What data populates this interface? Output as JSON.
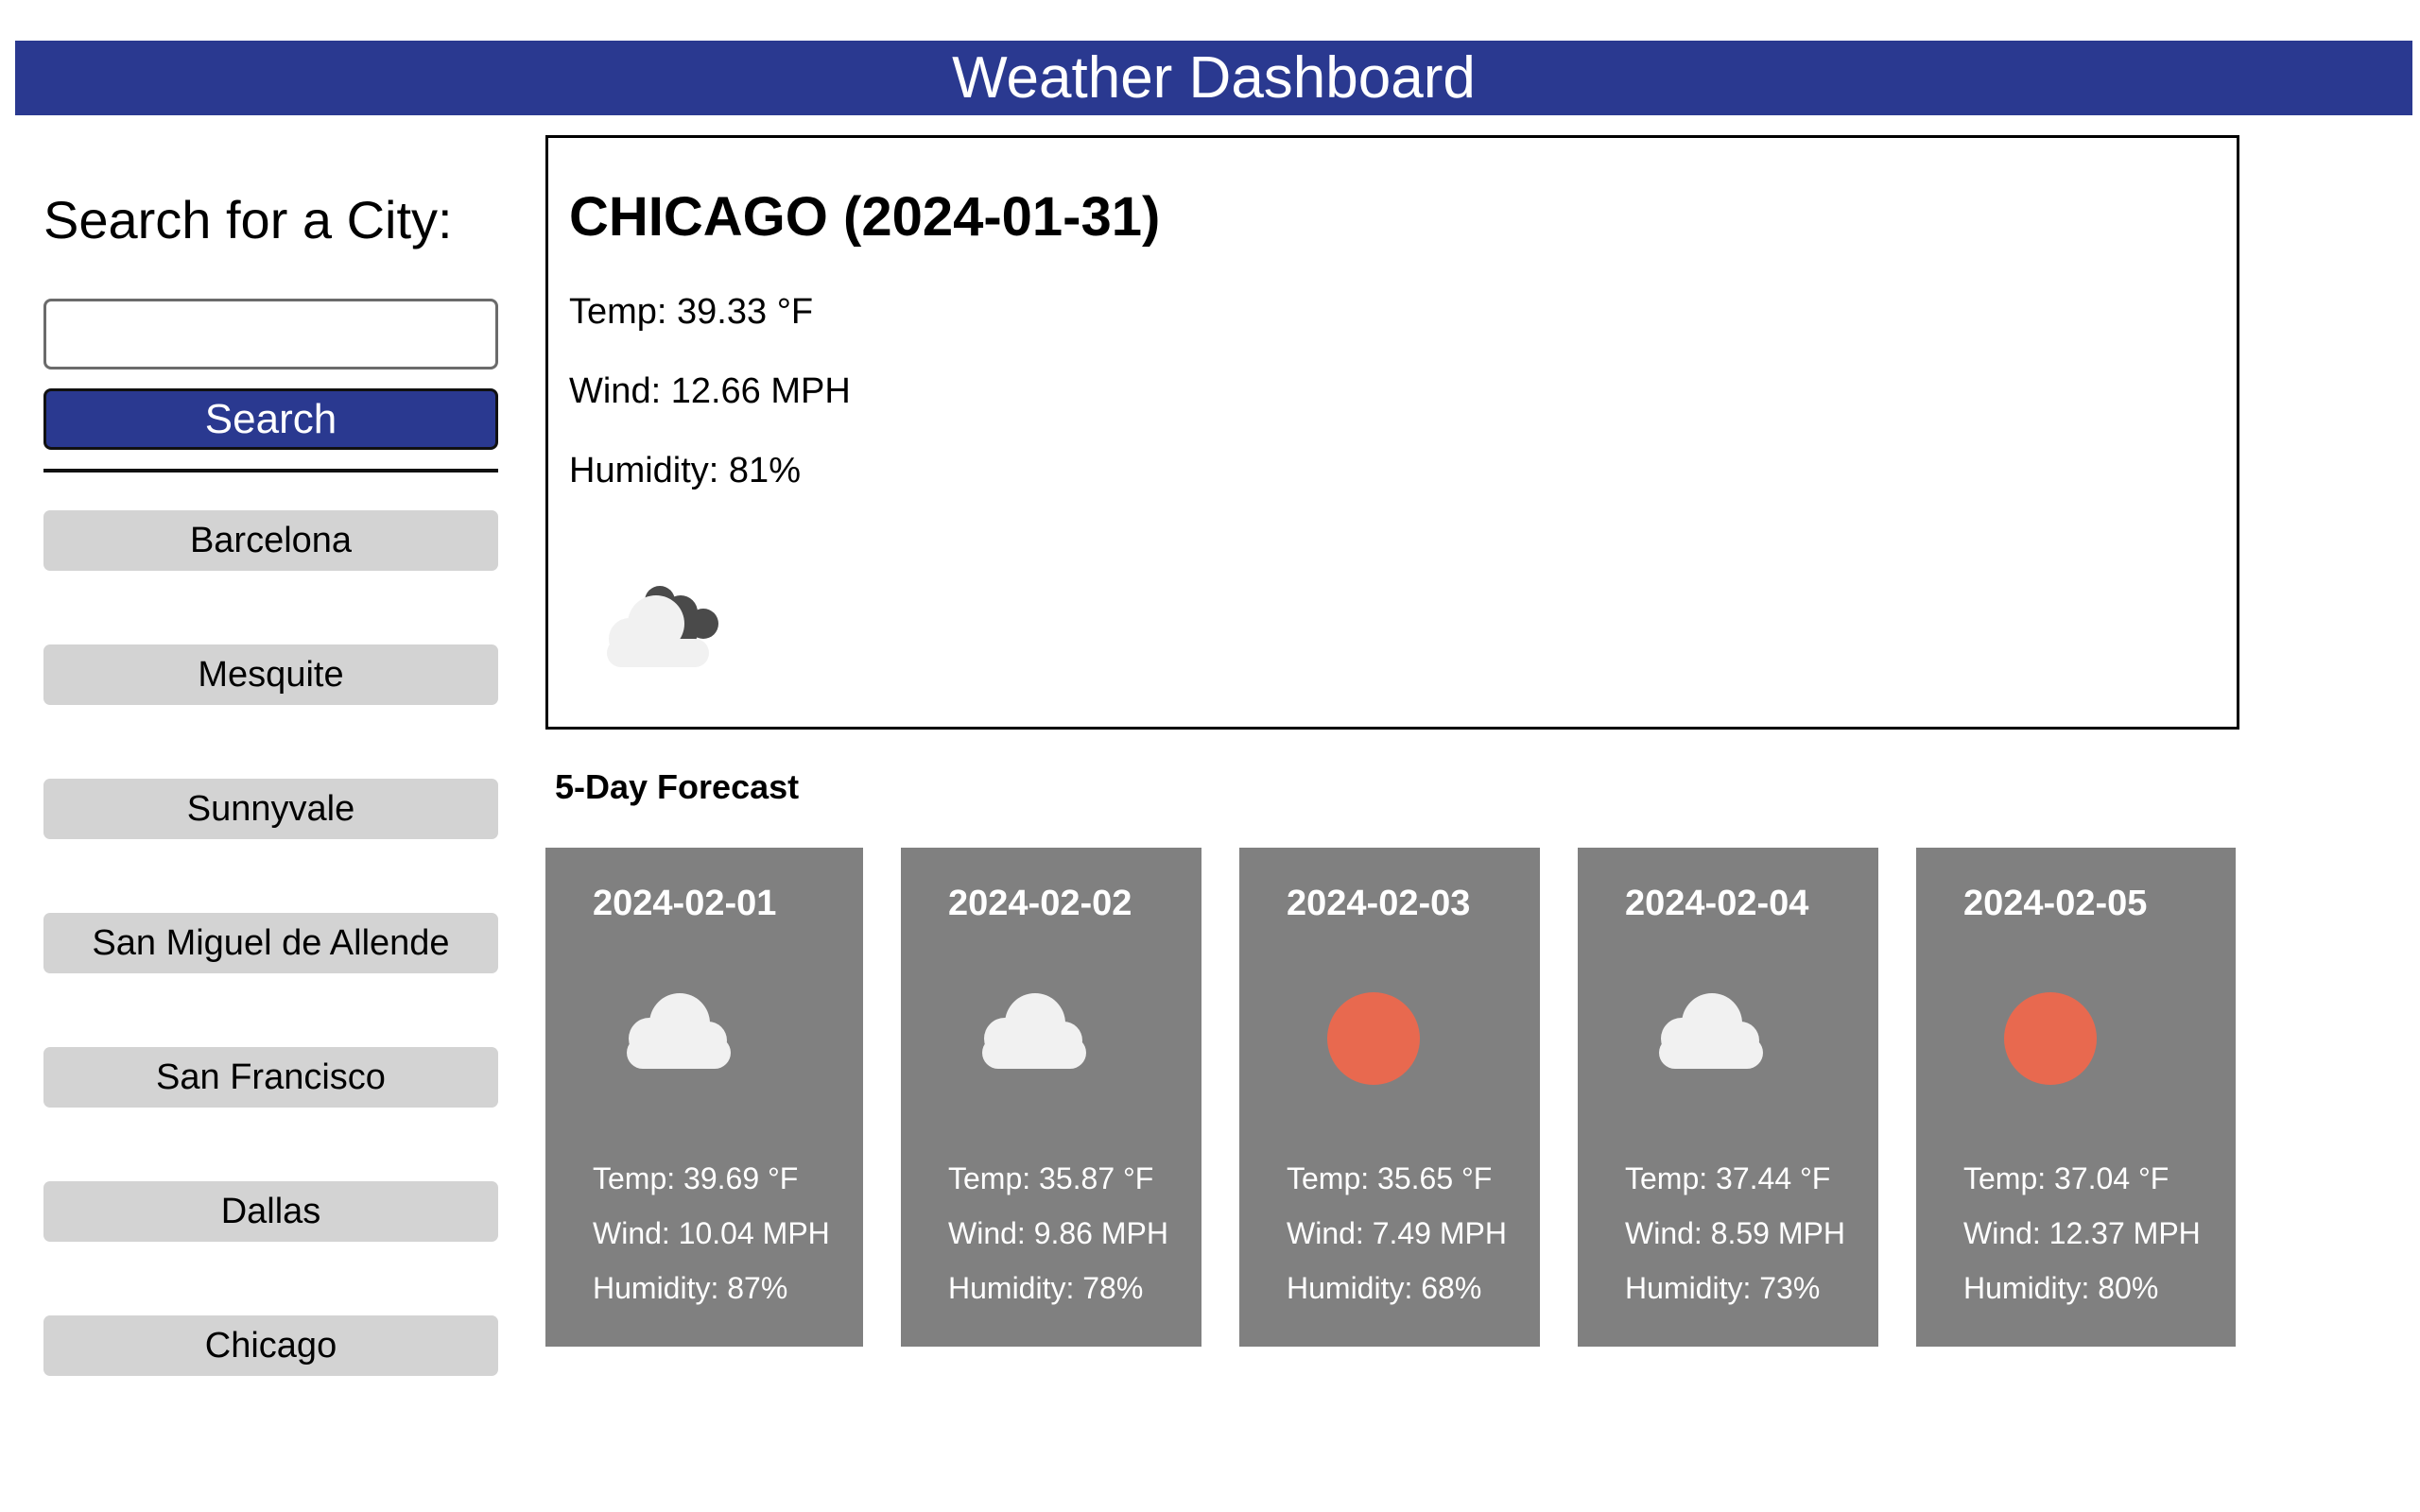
{
  "header": {
    "title": "Weather Dashboard"
  },
  "search": {
    "title": "Search for a City:",
    "value": "",
    "button_label": "Search"
  },
  "history": [
    "Barcelona",
    "Mesquite",
    "Sunnyvale",
    "San Miguel de Allende",
    "San Francisco",
    "Dallas",
    "Chicago"
  ],
  "current": {
    "title": "CHICAGO (2024-01-31)",
    "temp": "Temp: 39.33 °F",
    "wind": "Wind: 12.66 MPH",
    "humidity": "Humidity: 81%",
    "icon": "night-cloudy-icon"
  },
  "forecast": {
    "title": "5-Day Forecast",
    "days": [
      {
        "date": "2024-02-01",
        "icon": "cloud-icon",
        "temp": "Temp: 39.69 °F",
        "wind": "Wind: 10.04 MPH",
        "humidity": "Humidity: 87%"
      },
      {
        "date": "2024-02-02",
        "icon": "cloud-icon",
        "temp": "Temp: 35.87 °F",
        "wind": "Wind: 9.86 MPH",
        "humidity": "Humidity: 78%"
      },
      {
        "date": "2024-02-03",
        "icon": "sun-icon",
        "temp": "Temp: 35.65 °F",
        "wind": "Wind: 7.49 MPH",
        "humidity": "Humidity: 68%"
      },
      {
        "date": "2024-02-04",
        "icon": "cloud-icon",
        "temp": "Temp: 37.44 °F",
        "wind": "Wind: 8.59 MPH",
        "humidity": "Humidity: 73%"
      },
      {
        "date": "2024-02-05",
        "icon": "sun-icon",
        "temp": "Temp: 37.04 °F",
        "wind": "Wind: 12.37 MPH",
        "humidity": "Humidity: 80%"
      }
    ]
  },
  "colors": {
    "header_bg": "#2a3990",
    "history_btn_bg": "#d3d3d3",
    "card_bg": "#808080",
    "sun": "#e8694f",
    "cloud": "#f1f1f1",
    "dark_cloud": "#4a4a4a"
  }
}
